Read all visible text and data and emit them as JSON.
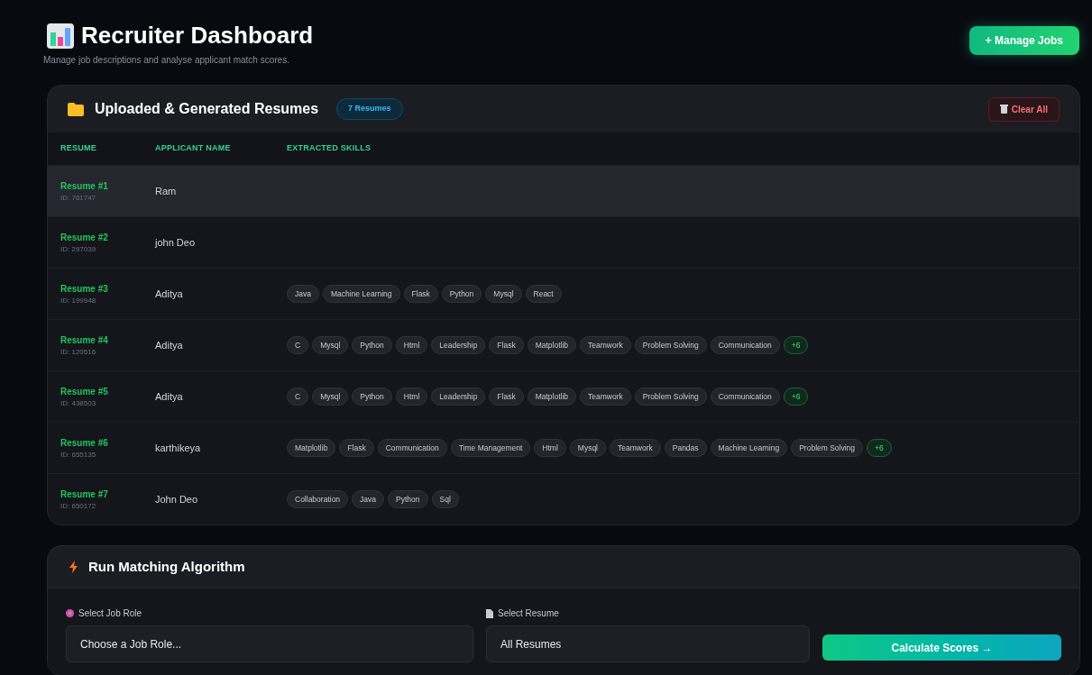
{
  "header": {
    "title": "Recruiter Dashboard",
    "subtitle": "Manage job descriptions and analyse applicant match scores.",
    "action": "+ Manage Jobs"
  },
  "resumes": {
    "title": "Uploaded & Generated Resumes",
    "count_badge": "7 Resumes",
    "clear_button": "Clear All",
    "columns": [
      "RESUME",
      "APPLICANT NAME",
      "EXTRACTED SKILLS"
    ],
    "rows": [
      {
        "label": "Resume #1",
        "id": "ID: 761747",
        "name": "Ram",
        "skills": [],
        "more": null,
        "selected": true
      },
      {
        "label": "Resume #2",
        "id": "ID: 297039",
        "name": "john Deo",
        "skills": [],
        "more": null,
        "selected": false
      },
      {
        "label": "Resume #3",
        "id": "ID: 199948",
        "name": "Aditya",
        "skills": [
          "Java",
          "Machine Learning",
          "Flask",
          "Python",
          "Mysql",
          "React"
        ],
        "more": null,
        "selected": false
      },
      {
        "label": "Resume #4",
        "id": "ID: 120516",
        "name": "Aditya",
        "skills": [
          "C",
          "Mysql",
          "Python",
          "Html",
          "Leadership",
          "Flask",
          "Matplotlib",
          "Teamwork",
          "Problem Solving",
          "Communication"
        ],
        "more": "+6",
        "selected": false
      },
      {
        "label": "Resume #5",
        "id": "ID: 438503",
        "name": "Aditya",
        "skills": [
          "C",
          "Mysql",
          "Python",
          "Html",
          "Leadership",
          "Flask",
          "Matplotlib",
          "Teamwork",
          "Problem Solving",
          "Communication"
        ],
        "more": "+6",
        "selected": false
      },
      {
        "label": "Resume #6",
        "id": "ID: 655135",
        "name": "karthikeya",
        "skills": [
          "Matplotlib",
          "Flask",
          "Communication",
          "Time Management",
          "Html",
          "Mysql",
          "Teamwork",
          "Pandas",
          "Machine Learning",
          "Problem Solving"
        ],
        "more": "+6",
        "selected": false
      },
      {
        "label": "Resume #7",
        "id": "ID: 650172",
        "name": "John Deo",
        "skills": [
          "Collaboration",
          "Java",
          "Python",
          "Sql"
        ],
        "more": null,
        "selected": false
      }
    ]
  },
  "matching": {
    "title": "Run Matching Algorithm",
    "job_label": "Select Job Role",
    "job_value": "Choose a Job Role...",
    "resume_label": "Select Resume",
    "resume_value": "All Resumes",
    "button": "Calculate Scores →"
  }
}
